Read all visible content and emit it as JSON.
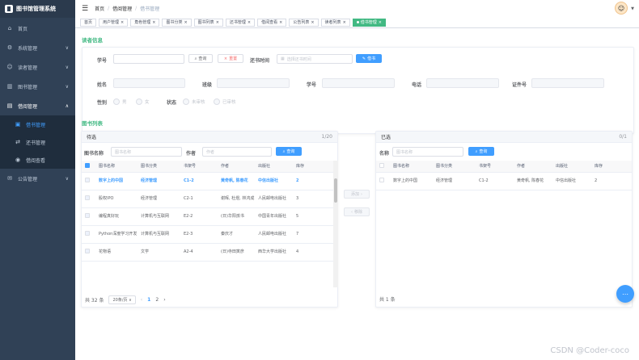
{
  "app": {
    "title": "图书馆管理系统"
  },
  "sidebar": {
    "items": [
      {
        "label": "首页",
        "icon": "home-icon"
      },
      {
        "label": "系统管理",
        "icon": "gear-icon"
      },
      {
        "label": "读者管理",
        "icon": "user-icon"
      },
      {
        "label": "图书管理",
        "icon": "books-icon"
      },
      {
        "label": "借阅管理",
        "icon": "borrow-icon"
      },
      {
        "label": "公告管理",
        "icon": "notice-icon"
      }
    ],
    "sub_items": [
      {
        "label": "借书管理"
      },
      {
        "label": "还书管理"
      },
      {
        "label": "借阅查看"
      }
    ]
  },
  "header": {
    "breadcrumb": [
      "首页",
      "借阅管理",
      "借书管理"
    ]
  },
  "tags": [
    "首页",
    "用户管理",
    "角色管理",
    "图书分类",
    "图书列表",
    "还书管理",
    "借阅查看",
    "公告列表",
    "读者列表",
    "借书管理"
  ],
  "reader_section": {
    "title": "读者信息",
    "search": {
      "student_id_label": "学号",
      "query_label": "查询",
      "reset_label": "重置",
      "return_time_label": "还书时间",
      "return_time_placeholder": "选择还书时间",
      "borrow_label": "借书"
    },
    "fields": {
      "name": "姓名",
      "class": "班级",
      "student_id": "学号",
      "phone": "电话",
      "id_no": "证件号",
      "gender": "性别",
      "male": "男",
      "female": "女",
      "status": "状态",
      "unaudited": "未审核",
      "audited": "已审核"
    }
  },
  "book_section": {
    "title": "图书列表",
    "left": {
      "header": "待选",
      "count": "1/20",
      "name_label": "图书名称",
      "name_placeholder": "图书名称",
      "author_label": "作者",
      "author_placeholder": "作者",
      "query_label": "查询",
      "columns": [
        "图书名称",
        "图书分类",
        "书架号",
        "作者",
        "出版社",
        "库存"
      ],
      "rows": [
        {
          "name": "数字上的中国",
          "category": "经济管理",
          "shelf": "C1-2",
          "author": "黄奇帆, 陈春花",
          "publisher": "中信出版社",
          "stock": "2",
          "selected": true
        },
        {
          "name": "股权IPO",
          "category": "经济管理",
          "shelf": "C2-1",
          "author": "谢晖, 杜煜, 林鸿成",
          "publisher": "人民邮电出版社",
          "stock": "3",
          "selected": false
        },
        {
          "name": "编程真好玩",
          "category": "计算机与互联网",
          "shelf": "E2-2",
          "author": "(日)华阳孩书",
          "publisher": "中国青年出版社",
          "stock": "5",
          "selected": false
        },
        {
          "name": "Python深度学习开发",
          "category": "计算机与互联网",
          "shelf": "E2-3",
          "author": "秦庆才",
          "publisher": "人民邮电出版社",
          "stock": "7",
          "selected": false
        },
        {
          "name": "花物语",
          "category": "文学",
          "shelf": "A2-4",
          "author": "(日)寺田寅彦",
          "publisher": "西华大学出版社",
          "stock": "4",
          "selected": false
        }
      ],
      "total": "共 32 条",
      "page_size": "20条/页",
      "pages": [
        "1",
        "2"
      ]
    },
    "transfer": {
      "add": "添加",
      "remove": "移除"
    },
    "right": {
      "header": "已选",
      "count": "0/1",
      "name_label": "名称",
      "name_placeholder": "图书名称",
      "query_label": "查询",
      "columns": [
        "图书名称",
        "图书分类",
        "书架号",
        "作者",
        "出版社",
        "库存"
      ],
      "rows": [
        {
          "name": "数字上的中国",
          "category": "经济管理",
          "shelf": "C1-2",
          "author": "黄奇帆, 陈春花",
          "publisher": "中信出版社",
          "stock": "2"
        }
      ],
      "total": "共 1 条"
    }
  },
  "watermark": "CSDN @Coder-coco",
  "colors": {
    "sidebar": "#304156",
    "accent": "#409eff",
    "green": "#42b983"
  }
}
